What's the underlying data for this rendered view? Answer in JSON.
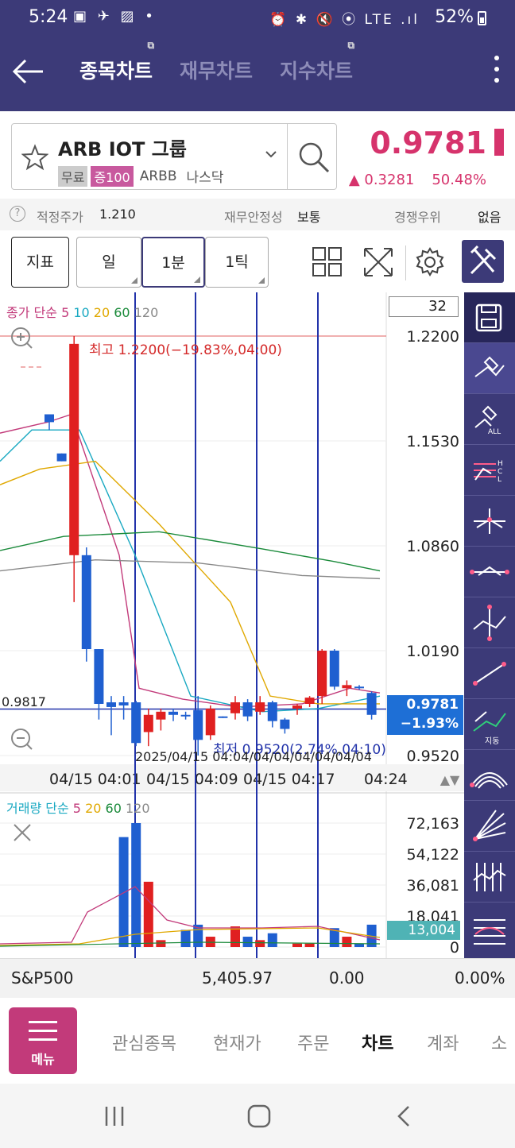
{
  "status_bar": {
    "time": "5:24",
    "left_icons": "▣ ✈ ▨ •",
    "right_icons": "⏰ ✱ 🔇 ⦿ LTE .ıl",
    "battery": "52%"
  },
  "header": {
    "tabs": [
      {
        "label": "종목차트",
        "active": true
      },
      {
        "label": "재무차트",
        "active": false
      },
      {
        "label": "지수차트",
        "active": false
      }
    ]
  },
  "stock": {
    "name": "ARB IOT 그룹",
    "tags": [
      "무료",
      "증100",
      "ARBB",
      "나스닥"
    ],
    "price": "0.9781",
    "change": "▲ 0.3281",
    "change_pct": "50.48%"
  },
  "info_row": {
    "fair_price_label": "적정주가",
    "fair_price": "1.210",
    "stability_label": "재무안정성",
    "stability": "보통",
    "competition_label": "경쟁우위",
    "competition": "없음"
  },
  "controls": {
    "indicator": "지표",
    "day": "일",
    "minute": "1분",
    "tick": "1틱"
  },
  "chart": {
    "count_box": "32",
    "ma_legend": {
      "prefix": "종가 단순",
      "p5": "5",
      "p10": "10",
      "p20": "20",
      "p60": "60",
      "p120": "120"
    },
    "high_label": "최고 1.2200(−19.83%,04:00)",
    "low_label": "최저 0.9520(2.74%,04:10)",
    "current_line_label": "0.9817",
    "current_price": "0.9781",
    "current_pct": "−1.93%",
    "date_overlap_text": "2025/04/15 04:04/04/04/04/04/04/04",
    "y_ticks": [
      "1.2200",
      "1.1530",
      "1.0860",
      "1.0190",
      "0.9520"
    ],
    "x_ticks": [
      "04/15 04:01",
      "04/15 04:09",
      "04/15 04:17",
      "04:24"
    ],
    "vol_legend": {
      "prefix": "거래량 단순",
      "p5": "5",
      "p20": "20",
      "p60": "60",
      "p120": "120"
    },
    "vol_ticks": [
      "72,163",
      "54,122",
      "36,081",
      "18,041",
      "0"
    ],
    "vol_current": "13,004",
    "side_label_trend": "지동"
  },
  "chart_data": {
    "type": "candlestick",
    "series": [
      {
        "o": 1.17,
        "h": 1.17,
        "l": 1.16,
        "c": 1.165
      },
      {
        "o": 1.145,
        "h": 1.145,
        "l": 1.14,
        "c": 1.14
      },
      {
        "o": 1.08,
        "h": 1.22,
        "l": 1.05,
        "c": 1.215
      },
      {
        "o": 1.08,
        "h": 1.085,
        "l": 1.012,
        "c": 1.02
      },
      {
        "o": 1.02,
        "h": 1.02,
        "l": 0.975,
        "c": 0.985
      },
      {
        "o": 0.986,
        "h": 0.99,
        "l": 0.965,
        "c": 0.983
      },
      {
        "o": 0.986,
        "h": 0.99,
        "l": 0.975,
        "c": 0.984
      },
      {
        "o": 0.986,
        "h": 0.987,
        "l": 0.958,
        "c": 0.96
      },
      {
        "o": 0.967,
        "h": 0.982,
        "l": 0.958,
        "c": 0.978
      },
      {
        "o": 0.975,
        "h": 0.982,
        "l": 0.968,
        "c": 0.98
      },
      {
        "o": 0.98,
        "h": 0.982,
        "l": 0.974,
        "c": 0.978
      },
      {
        "o": 0.978,
        "h": 0.98,
        "l": 0.975,
        "c": 0.977
      },
      {
        "o": 0.981,
        "h": 0.99,
        "l": 0.952,
        "c": 0.962
      },
      {
        "o": 0.965,
        "h": 0.984,
        "l": 0.962,
        "c": 0.982
      },
      {
        "o": 0.977,
        "h": 0.977,
        "l": 0.976,
        "c": 0.976
      },
      {
        "o": 0.979,
        "h": 0.99,
        "l": 0.975,
        "c": 0.986
      },
      {
        "o": 0.986,
        "h": 0.988,
        "l": 0.974,
        "c": 0.977
      },
      {
        "o": 0.98,
        "h": 0.99,
        "l": 0.978,
        "c": 0.986
      },
      {
        "o": 0.986,
        "h": 0.987,
        "l": 0.97,
        "c": 0.974
      },
      {
        "o": 0.975,
        "h": 0.976,
        "l": 0.966,
        "c": 0.969
      },
      {
        "o": 0.982,
        "h": 0.985,
        "l": 0.978,
        "c": 0.984
      },
      {
        "o": 0.985,
        "h": 0.99,
        "l": 0.983,
        "c": 0.989
      },
      {
        "o": 0.99,
        "h": 1.02,
        "l": 0.985,
        "c": 1.019
      },
      {
        "o": 1.019,
        "h": 1.02,
        "l": 0.994,
        "c": 0.996
      },
      {
        "o": 0.995,
        "h": 1.0,
        "l": 0.99,
        "c": 0.997
      },
      {
        "o": 0.996,
        "h": 0.997,
        "l": 0.994,
        "c": 0.995
      },
      {
        "o": 0.992,
        "h": 0.993,
        "l": 0.975,
        "c": 0.978
      }
    ],
    "volume": [
      0,
      0,
      0,
      0,
      0,
      0,
      64000,
      72163,
      38000,
      4000,
      0,
      10000,
      13000,
      6000,
      0,
      12000,
      6000,
      4000,
      8000,
      0,
      2000,
      2000,
      0,
      11000,
      6000,
      2000,
      13004
    ],
    "ylim": [
      0.952,
      1.22
    ],
    "vol_ylim": [
      0,
      72163
    ]
  },
  "sp500": {
    "name": "S&P500",
    "value": "5,405.97",
    "change": "0.00",
    "pct": "0.00%"
  },
  "bottom_nav": {
    "menu_label": "메뉴",
    "items": [
      "관심종목",
      "현재가",
      "주문",
      "차트",
      "계좌",
      "소"
    ]
  }
}
